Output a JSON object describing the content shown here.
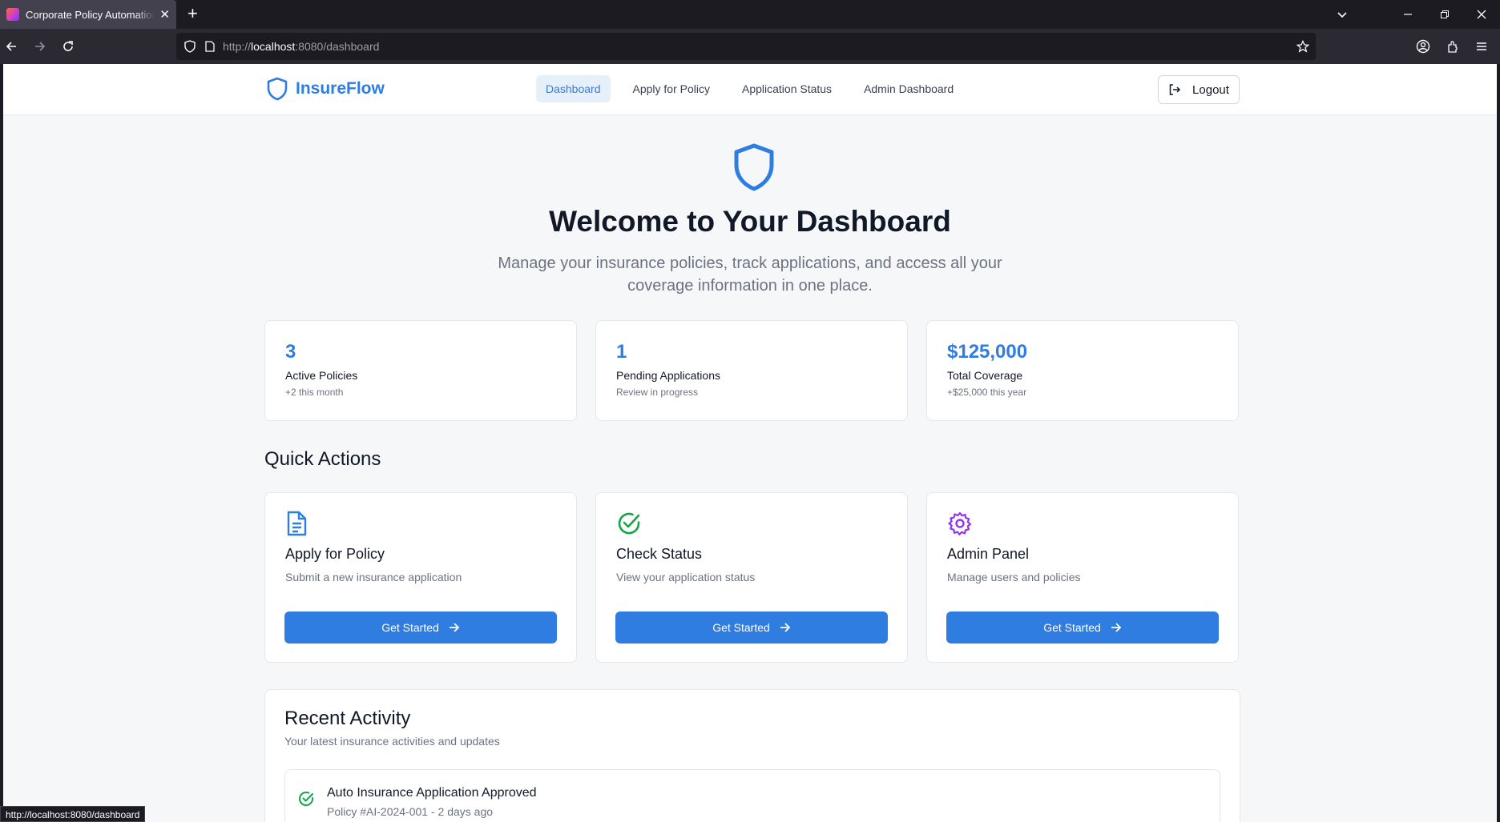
{
  "browser": {
    "tab_title": "Corporate Policy Automation Ap",
    "url_prefix": "http://",
    "url_host": "localhost",
    "url_path": ":8080/dashboard",
    "status_url": "http://localhost:8080/dashboard"
  },
  "header": {
    "brand": "InsureFlow",
    "nav": [
      {
        "label": "Dashboard",
        "active": true
      },
      {
        "label": "Apply for Policy",
        "active": false
      },
      {
        "label": "Application Status",
        "active": false
      },
      {
        "label": "Admin Dashboard",
        "active": false
      }
    ],
    "logout_label": "Logout"
  },
  "hero": {
    "title": "Welcome to Your Dashboard",
    "subtitle": "Manage your insurance policies, track applications, and access all your coverage information in one place."
  },
  "stats": [
    {
      "value": "3",
      "label": "Active Policies",
      "hint": "+2 this month"
    },
    {
      "value": "1",
      "label": "Pending Applications",
      "hint": "Review in progress"
    },
    {
      "value": "$125,000",
      "label": "Total Coverage",
      "hint": "+$25,000 this year"
    }
  ],
  "quick_actions": {
    "title": "Quick Actions",
    "items": [
      {
        "icon": "document-icon",
        "title": "Apply for Policy",
        "desc": "Submit a new insurance application",
        "button": "Get Started"
      },
      {
        "icon": "check-circle-icon",
        "title": "Check Status",
        "desc": "View your application status",
        "button": "Get Started"
      },
      {
        "icon": "gear-icon",
        "title": "Admin Panel",
        "desc": "Manage users and policies",
        "button": "Get Started"
      }
    ]
  },
  "recent": {
    "title": "Recent Activity",
    "subtitle": "Your latest insurance activities and updates",
    "items": [
      {
        "title": "Auto Insurance Application Approved",
        "meta": "Policy #AI-2024-001 - 2 days ago"
      }
    ]
  },
  "colors": {
    "accent": "#2f7de1",
    "success": "#16a34a",
    "admin": "#9333ea"
  }
}
